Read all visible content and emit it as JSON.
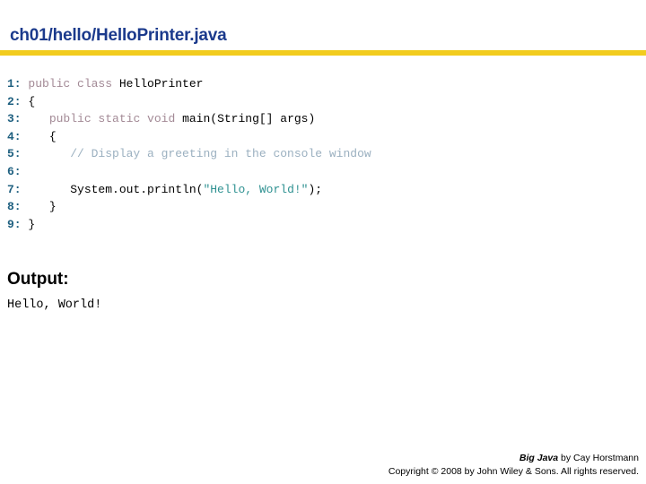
{
  "header": {
    "title": "ch01/hello/HelloPrinter.java",
    "rule_color": "#f2cc1e",
    "title_color": "#1b3a8c"
  },
  "code": {
    "syntax_colors": {
      "line_number": "#1f6080",
      "keyword": "#a38a96",
      "comment": "#9bb0c0",
      "string": "#2e9191",
      "plain": "#000000"
    },
    "lines": [
      {
        "number": "1:",
        "tokens": [
          {
            "text": " ",
            "type": "pln"
          },
          {
            "text": "public class ",
            "type": "kw"
          },
          {
            "text": "HelloPrinter",
            "type": "pln"
          }
        ]
      },
      {
        "number": "2:",
        "tokens": [
          {
            "text": " {",
            "type": "pln"
          }
        ]
      },
      {
        "number": "3:",
        "tokens": [
          {
            "text": "    ",
            "type": "pln"
          },
          {
            "text": "public static void ",
            "type": "kw"
          },
          {
            "text": "main(String[] args)",
            "type": "pln"
          }
        ]
      },
      {
        "number": "4:",
        "tokens": [
          {
            "text": "    {",
            "type": "pln"
          }
        ]
      },
      {
        "number": "5:",
        "tokens": [
          {
            "text": "       ",
            "type": "pln"
          },
          {
            "text": "// Display a greeting in the console window",
            "type": "cmt"
          }
        ]
      },
      {
        "number": "6:",
        "tokens": [
          {
            "text": "",
            "type": "pln"
          }
        ]
      },
      {
        "number": "7:",
        "tokens": [
          {
            "text": "       System.out.println(",
            "type": "pln"
          },
          {
            "text": "\"Hello, World!\"",
            "type": "str"
          },
          {
            "text": ");",
            "type": "pln"
          }
        ]
      },
      {
        "number": "8:",
        "tokens": [
          {
            "text": "    }",
            "type": "pln"
          }
        ]
      },
      {
        "number": "9:",
        "tokens": [
          {
            "text": " }",
            "type": "pln"
          }
        ]
      }
    ]
  },
  "output": {
    "heading": "Output:",
    "text": "Hello, World!"
  },
  "footer": {
    "book_title": "Big Java",
    "book_byline": " by Cay Horstmann",
    "copyright": "Copyright © 2008 by John Wiley & Sons.  All rights reserved."
  }
}
